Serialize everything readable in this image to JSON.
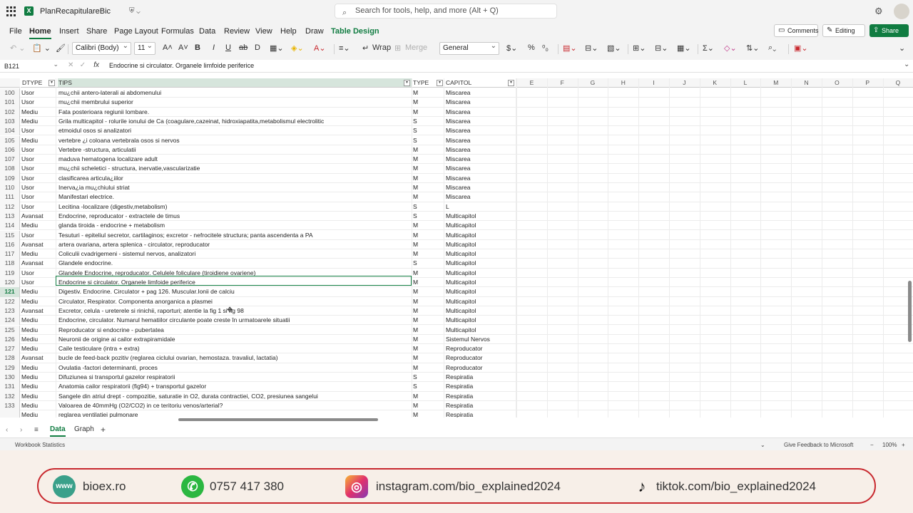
{
  "titlebar": {
    "doc_title": "PlanRecapitulareBic",
    "search_placeholder": "Search for tools, help, and more (Alt + Q)"
  },
  "menu": {
    "items": [
      "File",
      "Home",
      "Insert",
      "Share",
      "Page Layout",
      "Formulas",
      "Data",
      "Review",
      "View",
      "Help",
      "Draw",
      "Table Design"
    ],
    "active": "Home",
    "comments": "Comments",
    "editing": "Editing",
    "share": "Share"
  },
  "ribbon": {
    "font_name": "Calibri (Body)",
    "font_size": "11",
    "wrap": "Wrap",
    "merge": "Merge",
    "number_format": "General",
    "bold": "B",
    "italic": "I",
    "underline": "U",
    "strike": "ab"
  },
  "formula_bar": {
    "cell_ref": "B121",
    "fx": "fx",
    "content": "Endocrine si circulator. Organele limfoide periferice"
  },
  "grid": {
    "table_headers": [
      "DTYPE",
      "TIPS",
      "TYPE",
      "CAPITOL"
    ],
    "column_letters": [
      "E",
      "F",
      "G",
      "H",
      "I",
      "J",
      "K",
      "L",
      "M",
      "N",
      "O",
      "P",
      "Q"
    ],
    "rows": [
      {
        "n": "100",
        "a": "Usor",
        "b": "mu¿chii antero-laterali ai abdomenului",
        "c": "M",
        "d": "Miscarea"
      },
      {
        "n": "101",
        "a": "Usor",
        "b": "mu¿chii membrului superior",
        "c": "M",
        "d": "Miscarea"
      },
      {
        "n": "102",
        "a": "Mediu",
        "b": "Fata posterioara regiunii lombare.",
        "c": "M",
        "d": "Miscarea"
      },
      {
        "n": "103",
        "a": "Mediu",
        "b": "Grila multicapitol - rolurile ionului de Ca (coagulare,cazeinat, hidroxiapatita,metabolismul electrolitic",
        "c": "S",
        "d": "Miscarea"
      },
      {
        "n": "104",
        "a": "Usor",
        "b": "etmoidul osos si analizatori",
        "c": "S",
        "d": "Miscarea"
      },
      {
        "n": "105",
        "a": "Mediu",
        "b": "vertebre ¿i coloana vertebrala osos si nervos",
        "c": "S",
        "d": "Miscarea"
      },
      {
        "n": "106",
        "a": "Usor",
        "b": "Vertebre -structura, articulatii",
        "c": "M",
        "d": "Miscarea"
      },
      {
        "n": "107",
        "a": "Usor",
        "b": "maduva hematogena localizare adult",
        "c": "M",
        "d": "Miscarea"
      },
      {
        "n": "108",
        "a": "Usor",
        "b": "mu¿chii scheletici - structura, inervatie,vascularizatie",
        "c": "M",
        "d": "Miscarea"
      },
      {
        "n": "109",
        "a": "Usor",
        "b": "clasificarea articula¿iilor",
        "c": "M",
        "d": "Miscarea"
      },
      {
        "n": "110",
        "a": "Usor",
        "b": "Inerva¿ia mu¿chiului striat",
        "c": "M",
        "d": "Miscarea"
      },
      {
        "n": "111",
        "a": "Usor",
        "b": "Manifestari electrice.",
        "c": "M",
        "d": "Miscarea"
      },
      {
        "n": "112",
        "a": "Usor",
        "b": "Lecitina -localizare (digestiv,metabolism)",
        "c": "S",
        "d": "L"
      },
      {
        "n": "113",
        "a": "Avansat",
        "b": "Endocrine, reproducator - extractele de timus",
        "c": "S",
        "d": "Multicapitol"
      },
      {
        "n": "114",
        "a": "Mediu",
        "b": "glanda tiroida - endocrine + metabolism",
        "c": "M",
        "d": "Multicapitol"
      },
      {
        "n": "115",
        "a": "Usor",
        "b": "Tesuturi - epiteliul secretor, cartilaginos; excretor - nefrocitele structura; panta ascendenta a PA",
        "c": "M",
        "d": "Multicapitol"
      },
      {
        "n": "116",
        "a": "Avansat",
        "b": "artera ovariana, artera splenica - circulator, reproducator",
        "c": "M",
        "d": "Multicapitol"
      },
      {
        "n": "117",
        "a": "Mediu",
        "b": "Coliculii cvadrigemeni - sistemul nervos, analizatori",
        "c": "M",
        "d": "Multicapitol"
      },
      {
        "n": "118",
        "a": "Avansat",
        "b": "Glandele endocrine.",
        "c": "S",
        "d": "Multicapitol"
      },
      {
        "n": "119",
        "a": "Usor",
        "b": "Glandele Endocrine, reproducator. Celulele foliculare (tiroidiene ovariene)",
        "c": "M",
        "d": "Multicapitol"
      },
      {
        "n": "120",
        "a": "Usor",
        "b": "Endocrine si circulator. Organele limfoide periferice",
        "c": "M",
        "d": "Multicapitol"
      },
      {
        "n": "121",
        "a": "Mediu",
        "b": "Digestiv. Endocrine. Circulator + pag 126. Muscular.Ionii de calciu",
        "c": "M",
        "d": "Multicapitol"
      },
      {
        "n": "122",
        "a": "Mediu",
        "b": "Circulator, Respirator. Componenta anorganica a plasmei",
        "c": "M",
        "d": "Multicapitol"
      },
      {
        "n": "123",
        "a": "Avansat",
        "b": "Excretor, celula - ureterele si rinichii, raporturi; atentie la fig 1 si fig 98",
        "c": "M",
        "d": "Multicapitol"
      },
      {
        "n": "124",
        "a": "Mediu",
        "b": "Endocrine, circulator. Numarul hematiilor circulante poate creste în urmatoarele situatii",
        "c": "M",
        "d": "Multicapitol"
      },
      {
        "n": "125",
        "a": "Mediu",
        "b": "Reproducator  si endocrine - pubertatea",
        "c": "M",
        "d": "Multicapitol"
      },
      {
        "n": "126",
        "a": "Mediu",
        "b": "Neuronii de origine ai cailor extrapiramidale",
        "c": "M",
        "d": "Sistemul Nervos"
      },
      {
        "n": "127",
        "a": "Mediu",
        "b": "Caile testiculare (intra + extra)",
        "c": "M",
        "d": "Reproducator"
      },
      {
        "n": "128",
        "a": "Avansat",
        "b": "bucle de feed-back pozitiv (reglarea ciclului ovarian, hemostaza. travaliul, lactatia)",
        "c": "M",
        "d": "Reproducator"
      },
      {
        "n": "129",
        "a": "Mediu",
        "b": "Ovulatia -factori determinanti, proces",
        "c": "M",
        "d": "Reproducator"
      },
      {
        "n": "130",
        "a": "Mediu",
        "b": "Difuziunea si transportul gazelor respiratorii",
        "c": "S",
        "d": "Respiratia"
      },
      {
        "n": "131",
        "a": "Mediu",
        "b": "Anatomia cailor respiratorii (fig94) + transportul gazelor",
        "c": "S",
        "d": "Respiratia"
      },
      {
        "n": "132",
        "a": "Mediu",
        "b": "Sangele din atriul drept - compozitie, saturatie in O2, durata contractiei, CO2, presiunea sangelui",
        "c": "M",
        "d": "Respiratia"
      },
      {
        "n": "133",
        "a": "Mediu",
        "b": "Valoarea de 40mmHg (O2/CO2) in ce teritoriu venos/arterial?",
        "c": "M",
        "d": "Respiratia"
      },
      {
        "n": "",
        "a": "Mediu",
        "b": "reglarea ventilatiei pulmonare",
        "c": "M",
        "d": "Respiratia"
      }
    ]
  },
  "sheets": {
    "tabs": [
      "Data",
      "Graph"
    ],
    "active": "Data"
  },
  "status": {
    "left": "Workbook Statistics",
    "feedback": "Give Feedback to Microsoft",
    "zoom": "100%"
  },
  "banner": {
    "website": "bioex.ro",
    "phone": "0757 417 380",
    "instagram": "instagram.com/bio_explained2024",
    "tiktok": "tiktok.com/bio_explained2024",
    "www_label": "www"
  }
}
